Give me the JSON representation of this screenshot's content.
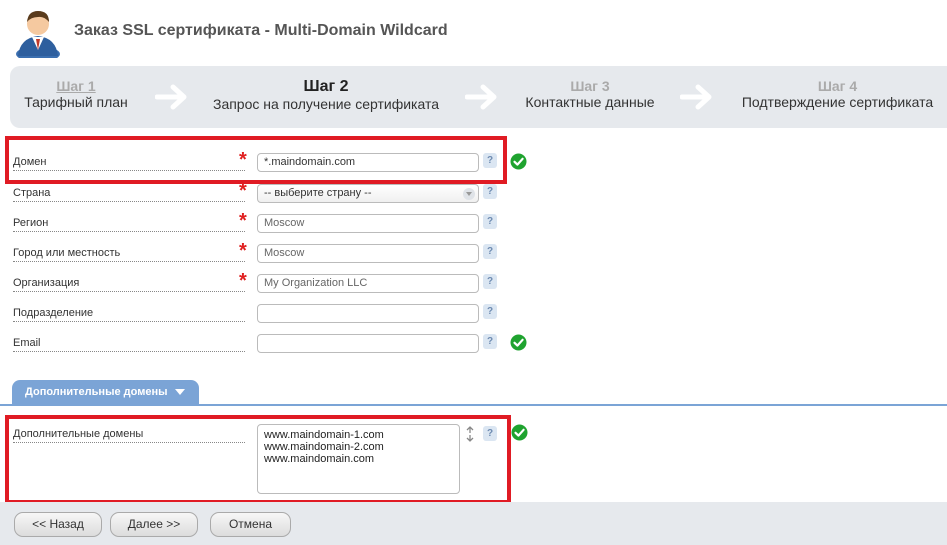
{
  "header": {
    "title": "Заказ SSL сертификата -  Multi-Domain Wildcard",
    "avatar_icon": "user-avatar-icon"
  },
  "steps": [
    {
      "num": "Шаг 1",
      "label": "Тарифный план"
    },
    {
      "num": "Шаг 2",
      "label": "Запрос на получение сертификата"
    },
    {
      "num": "Шаг 3",
      "label": "Контактные данные"
    },
    {
      "num": "Шаг 4",
      "label": "Подтверждение сертификата"
    }
  ],
  "form": {
    "domain": {
      "label": "Домен",
      "value": "*.maindomain.com",
      "required": true,
      "valid": true
    },
    "country": {
      "label": "Страна",
      "value": "-- выберите страну --",
      "required": true
    },
    "region": {
      "label": "Регион",
      "value": "Moscow",
      "required": true
    },
    "city": {
      "label": "Город или местность",
      "value": "Moscow",
      "required": true
    },
    "organization": {
      "label": "Организация",
      "value": "My Organization LLC",
      "required": true
    },
    "department": {
      "label": "Подразделение",
      "value": "",
      "required": false
    },
    "email": {
      "label": "Email",
      "value": "",
      "required": false,
      "valid": true
    },
    "help_symbol": "?",
    "required_symbol": "*"
  },
  "extra_section": {
    "tab_label": "Дополнительные домены",
    "field_label": "Дополнительные домены",
    "domains": [
      "www.maindomain-1.com",
      "www.maindomain-2.com",
      "www.maindomain.com"
    ]
  },
  "buttons": {
    "back": "<< Назад",
    "next": "Далее >>",
    "cancel": "Отмена"
  },
  "colors": {
    "highlight_red": "#e01b24",
    "valid_green": "#1fa32f",
    "section_blue": "#7ba4d6",
    "required_red": "#e02020"
  }
}
